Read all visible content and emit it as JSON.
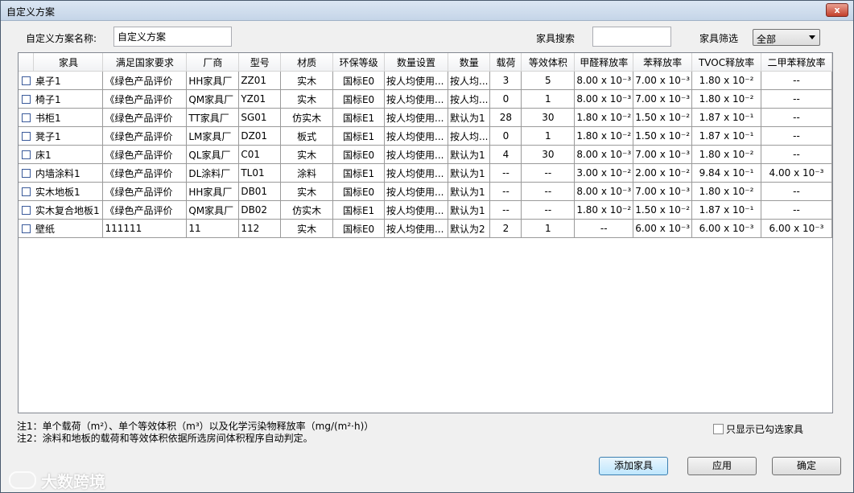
{
  "window": {
    "title": "自定义方案",
    "close": "x"
  },
  "form": {
    "scheme_label": "自定义方案名称:",
    "scheme_value": "自定义方案",
    "search_label": "家具搜索",
    "search_value": "",
    "filter_label": "家具筛选",
    "filter_value": "全部"
  },
  "table": {
    "headers": [
      "",
      "家具",
      "满足国家要求",
      "厂商",
      "型号",
      "材质",
      "环保等级",
      "数量设置",
      "数量",
      "载荷",
      "等效体积",
      "甲醛释放率",
      "苯释放率",
      "TVOC释放率",
      "二甲苯释放率"
    ],
    "rows": [
      [
        "桌子1",
        "《绿色产品评价",
        "HH家具厂",
        "ZZ01",
        "实木",
        "国标E0",
        "按人均使用...",
        "按人均...",
        "3",
        "5",
        "8.00 x 10⁻³",
        "7.00 x 10⁻³",
        "1.80 x 10⁻²",
        "--"
      ],
      [
        "椅子1",
        "《绿色产品评价",
        "QM家具厂",
        "YZ01",
        "实木",
        "国标E0",
        "按人均使用...",
        "按人均...",
        "0",
        "1",
        "8.00 x 10⁻³",
        "7.00 x 10⁻³",
        "1.80 x 10⁻²",
        "--"
      ],
      [
        "书柜1",
        "《绿色产品评价",
        "TT家具厂",
        "SG01",
        "仿实木",
        "国标E1",
        "按人均使用...",
        "默认为1",
        "28",
        "30",
        "1.80 x 10⁻²",
        "1.50 x 10⁻²",
        "1.87 x 10⁻¹",
        "--"
      ],
      [
        "凳子1",
        "《绿色产品评价",
        "LM家具厂",
        "DZ01",
        "板式",
        "国标E1",
        "按人均使用...",
        "按人均...",
        "0",
        "1",
        "1.80 x 10⁻²",
        "1.50 x 10⁻²",
        "1.87 x 10⁻¹",
        "--"
      ],
      [
        "床1",
        "《绿色产品评价",
        "QL家具厂",
        "C01",
        "实木",
        "国标E0",
        "按人均使用...",
        "默认为1",
        "4",
        "30",
        "8.00 x 10⁻³",
        "7.00 x 10⁻³",
        "1.80 x 10⁻²",
        "--"
      ],
      [
        "内墙涂料1",
        "《绿色产品评价",
        "DL涂料厂",
        "TL01",
        "涂料",
        "国标E1",
        "按人均使用...",
        "默认为1",
        "--",
        "--",
        "3.00 x 10⁻²",
        "2.00 x 10⁻²",
        "9.84 x 10⁻¹",
        "4.00 x 10⁻³"
      ],
      [
        "实木地板1",
        "《绿色产品评价",
        "HH家具厂",
        "DB01",
        "实木",
        "国标E0",
        "按人均使用...",
        "默认为1",
        "--",
        "--",
        "8.00 x 10⁻³",
        "7.00 x 10⁻³",
        "1.80 x 10⁻²",
        "--"
      ],
      [
        "实木复合地板1",
        "《绿色产品评价",
        "QM家具厂",
        "DB02",
        "仿实木",
        "国标E1",
        "按人均使用...",
        "默认为1",
        "--",
        "--",
        "1.80 x 10⁻²",
        "1.50 x 10⁻²",
        "1.87 x 10⁻¹",
        "--"
      ],
      [
        "壁纸",
        "111111",
        "11",
        "112",
        "实木",
        "国标E0",
        "按人均使用...",
        "默认为2",
        "2",
        "1",
        "--",
        "6.00 x 10⁻³",
        "6.00 x 10⁻³",
        "6.00 x 10⁻³"
      ]
    ]
  },
  "notes": {
    "note1": "注1：单个载荷（m²）、单个等效体积（m³）以及化学污染物释放率（mg/(m²·h)）",
    "note2": "注2：涂料和地板的载荷和等效体积依据所选房间体积程序自动判定。"
  },
  "show_selected_label": "只显示已勾选家具",
  "buttons": {
    "add": "添加家具",
    "apply": "应用",
    "ok": "确定"
  },
  "watermark": "大数跨境"
}
